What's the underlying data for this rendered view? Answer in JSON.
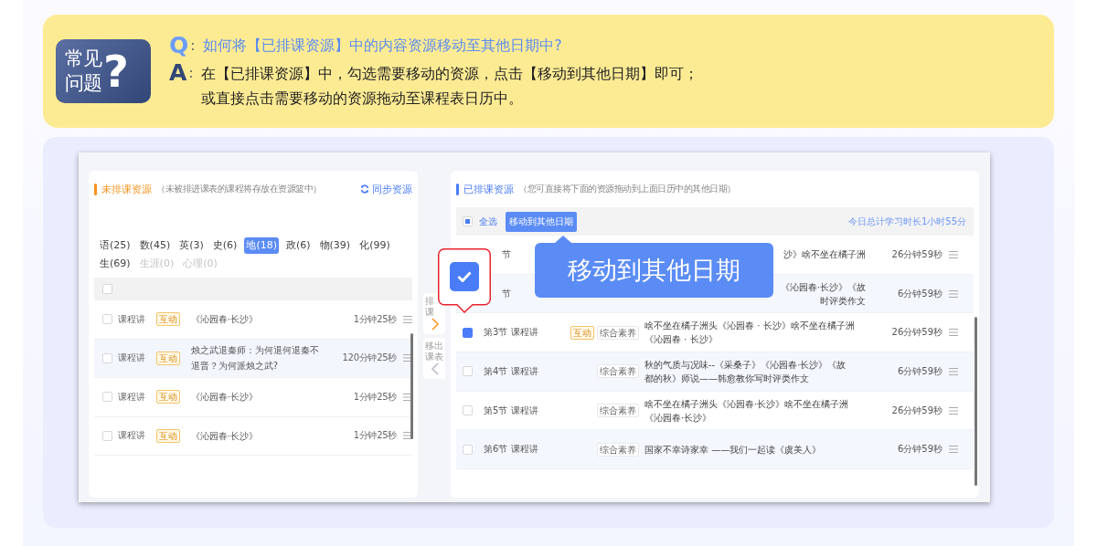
{
  "faq": {
    "badge_lines": [
      "常见",
      "问题"
    ],
    "badge_mark": "?",
    "question": {
      "label": "Q",
      "sep": ":",
      "text": "如何将【已排课资源】中的内容资源移动至其他日期中?"
    },
    "answer": {
      "label": "A",
      "sep": ":",
      "lines": [
        "在【已排课资源】中，勾选需要移动的资源，点击【移动到其他日期】即可；",
        "或直接点击需要移动的资源拖动至课程表日历中。"
      ]
    }
  },
  "left": {
    "title": "未排课资源",
    "hint": "（未被排进课表的课程将存放在资源篮中）",
    "sync": "同步资源",
    "subjects": [
      {
        "label": "语(25)",
        "selected": false,
        "disabled": false
      },
      {
        "label": "数(45)",
        "selected": false,
        "disabled": false
      },
      {
        "label": "英(3)",
        "selected": false,
        "disabled": false
      },
      {
        "label": "史(6)",
        "selected": false,
        "disabled": false
      },
      {
        "label": "地(18)",
        "selected": true,
        "disabled": false
      },
      {
        "label": "政(6)",
        "selected": false,
        "disabled": false
      },
      {
        "label": "物(39)",
        "selected": false,
        "disabled": false
      },
      {
        "label": "化(99)",
        "selected": false,
        "disabled": false
      },
      {
        "label": "生(69)",
        "selected": false,
        "disabled": false
      },
      {
        "label": "生涯(0)",
        "selected": false,
        "disabled": true
      },
      {
        "label": "心理(0)",
        "selected": false,
        "disabled": true
      }
    ],
    "header_checked": false,
    "rows": [
      {
        "type": "课程讲",
        "tag": "互动",
        "title": "《沁园春·长沙》",
        "duration": "1分钟25秒",
        "checked": false,
        "highlighted": false
      },
      {
        "type": "课程讲",
        "tag": "互动",
        "title": "烛之武退秦师：为何退何退秦不退晋？为何派烛之武?",
        "duration": "120分钟25秒",
        "checked": false,
        "highlighted": true
      },
      {
        "type": "课程讲",
        "tag": "互动",
        "title": "《沁园春·长沙》",
        "duration": "1分钟25秒",
        "checked": false,
        "highlighted": false
      },
      {
        "type": "课程讲",
        "tag": "互动",
        "title": "《沁园春·长沙》",
        "duration": "1分钟25秒",
        "checked": false,
        "highlighted": false
      }
    ]
  },
  "middle": [
    {
      "lines": [
        "排",
        "课"
      ],
      "kind": "move_in"
    },
    {
      "lines": [
        "移出",
        "课表"
      ],
      "kind": "move_out"
    }
  ],
  "right": {
    "title": "已排课资源",
    "hint": "（您可直接将下面的资源拖动到上面日历中的其他日期）",
    "select_all": "全选",
    "select_all_partial": true,
    "move_button": "移动到其他日期",
    "total": "今日总计学习时长1小时55分",
    "rows": [
      {
        "number": "节",
        "tags": [],
        "title_lines": [
          "沙》啥不坐在橘子洲"
        ],
        "duration": "26分钟59秒",
        "clipped": true
      },
      {
        "number": "节",
        "tags": [],
        "title_lines": [
          "《沁园春·长沙》《故",
          "时评类作文"
        ],
        "duration": "6分钟59秒",
        "clipped": true
      },
      {
        "number": "第3节",
        "type": "课程讲",
        "tags": [
          {
            "label": "互动",
            "kind": "interactive"
          },
          {
            "label": "综合素养",
            "kind": "literacy"
          }
        ],
        "title_lines": [
          "啥不坐在橘子洲头《沁园春 · 长沙》啥不坐在橘子洲",
          "《沁园春 · 长沙》"
        ],
        "duration": "26分钟59秒",
        "checked": true,
        "clipped": false
      },
      {
        "number": "第4节",
        "type": "课程讲",
        "tags": [
          {
            "label": "综合素养",
            "kind": "literacy"
          }
        ],
        "title_lines": [
          "秋的气质与况味--《采桑子》《沁园春·长沙》《故",
          "都的秋》师说——韩愈教你写时评类作文"
        ],
        "duration": "6分钟59秒",
        "checked": false,
        "clipped": false
      },
      {
        "number": "第5节",
        "type": "课程讲",
        "tags": [
          {
            "label": "综合素养",
            "kind": "literacy"
          }
        ],
        "title_lines": [
          "啥不坐在橘子洲头《沁园春·长沙》啥不坐在橘子洲",
          "《沁园春·长沙》"
        ],
        "duration": "26分钟59秒",
        "checked": false,
        "clipped": false
      },
      {
        "number": "第6节",
        "type": "课程讲",
        "tags": [
          {
            "label": "综合素养",
            "kind": "literacy"
          }
        ],
        "title_lines": [
          "国家不幸诗家幸 ——我们一起读《虞美人》"
        ],
        "duration": "6分钟59秒",
        "checked": false,
        "clipped": false
      }
    ]
  },
  "zoom_checkbox": {
    "checked": true
  },
  "callout": {
    "text": "移动到其他日期"
  }
}
